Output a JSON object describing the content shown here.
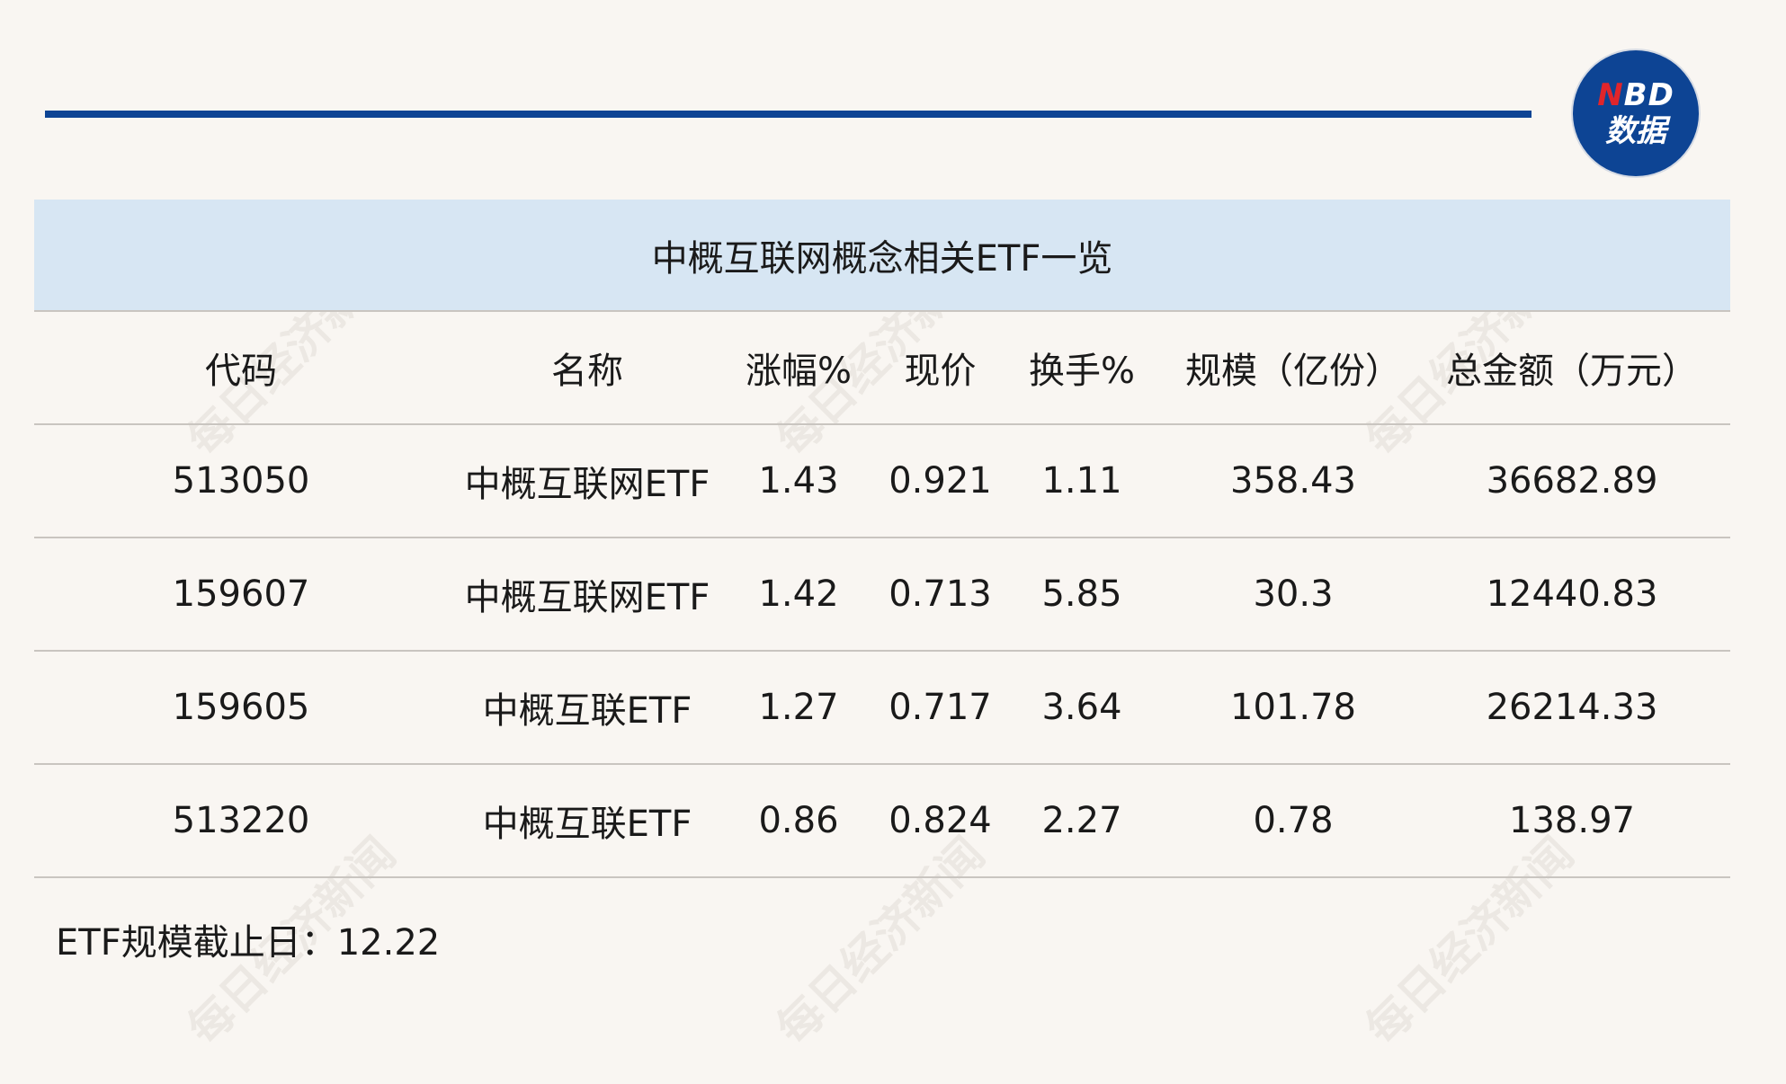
{
  "logo": {
    "line1_n": "N",
    "line1_rest": "BD",
    "line2": "数据"
  },
  "watermark_text": "每日经济新闻",
  "table": {
    "title": "中概互联网概念相关ETF一览",
    "headers": [
      "代码",
      "名称",
      "涨幅%",
      "现价",
      "换手%",
      "规模（亿份）",
      "总金额（万元）"
    ],
    "rows": [
      [
        "513050",
        "中概互联网ETF",
        "1.43",
        "0.921",
        "1.11",
        "358.43",
        "36682.89"
      ],
      [
        "159607",
        "中概互联网ETF",
        "1.42",
        "0.713",
        "5.85",
        "30.3",
        "12440.83"
      ],
      [
        "159605",
        "中概互联ETF",
        "1.27",
        "0.717",
        "3.64",
        "101.78",
        "26214.33"
      ],
      [
        "513220",
        "中概互联ETF",
        "0.86",
        "0.824",
        "2.27",
        "0.78",
        "138.97"
      ]
    ]
  },
  "footnote": "ETF规模截止日：12.22",
  "colors": {
    "accent": "#0d4494",
    "title_bg": "#d7e6f3",
    "page_bg": "#f9f6f2",
    "logo_red": "#e0252b"
  }
}
